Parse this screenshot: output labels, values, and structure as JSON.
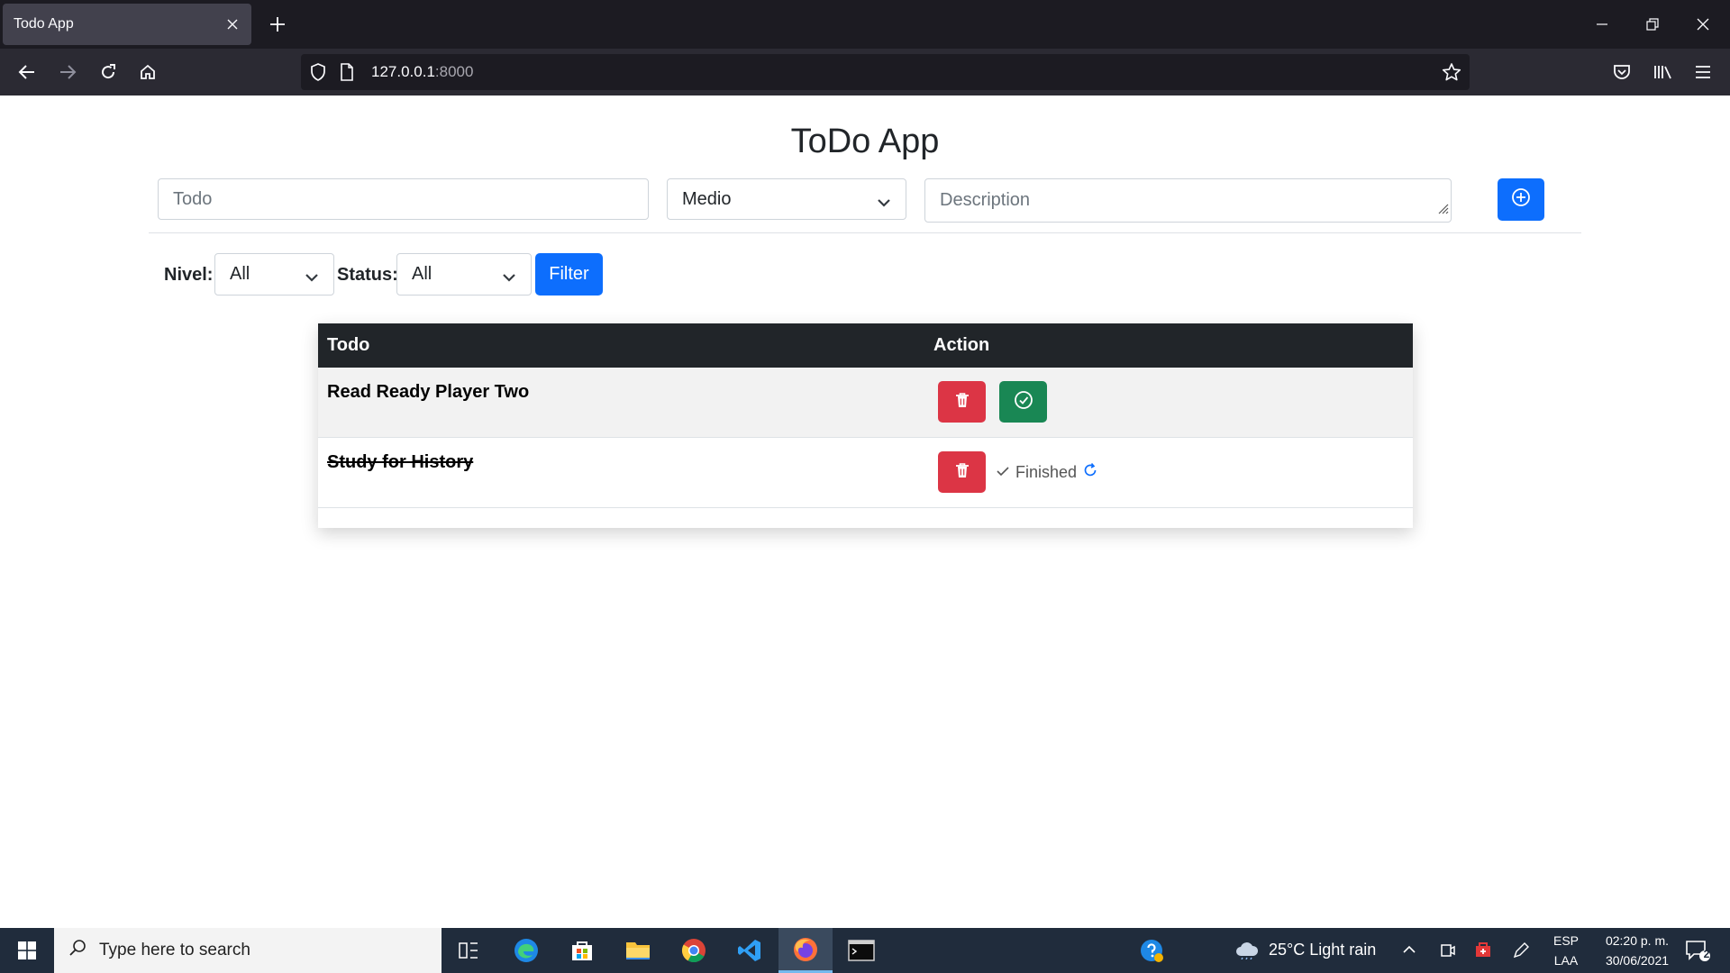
{
  "browser": {
    "tab_title": "Todo App",
    "url_host": "127.0.0.1",
    "url_port": ":8000"
  },
  "page": {
    "title": "ToDo App",
    "form": {
      "todo_placeholder": "Todo",
      "level_selected": "Medio",
      "description_placeholder": "Description"
    },
    "filters": {
      "nivel_label": "Nivel:",
      "nivel_value": "All",
      "status_label": "Status:",
      "status_value": "All",
      "filter_button": "Filter"
    },
    "table": {
      "headers": [
        "Todo",
        "Action"
      ],
      "rows": [
        {
          "title": "Read Ready Player Two",
          "done": false
        },
        {
          "title": "Study for History",
          "done": true,
          "status_text": "Finished"
        }
      ]
    }
  },
  "taskbar": {
    "search_placeholder": "Type here to search",
    "weather": "25°C  Light rain",
    "lang_top": "ESP",
    "lang_bottom": "LAA",
    "time": "02:20 p. m.",
    "date": "30/06/2021",
    "notification_count": "2"
  },
  "colors": {
    "primary": "#0d6efd",
    "danger": "#dc3545",
    "success": "#198754",
    "table_header": "#212529"
  }
}
